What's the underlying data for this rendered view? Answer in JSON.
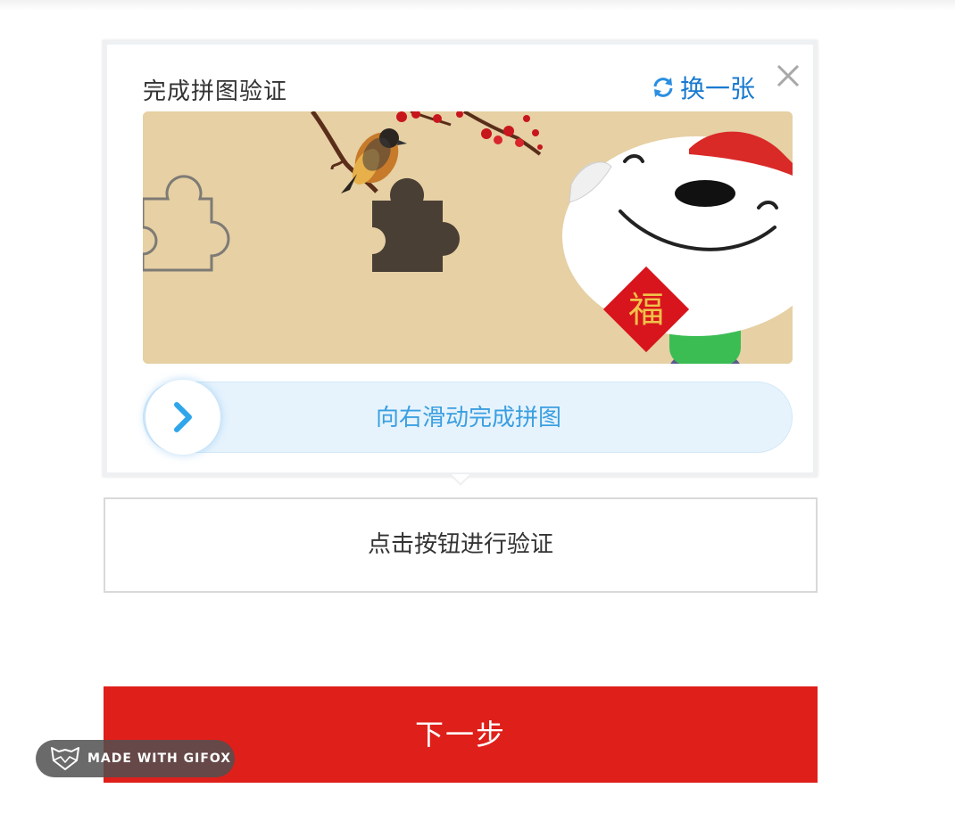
{
  "captcha": {
    "title": "完成拼图验证",
    "refresh_label": "换一张",
    "close_icon": "close-icon",
    "refresh_icon": "refresh-icon",
    "image_badge": "福",
    "slider_hint": "向右滑动完成拼图",
    "slider_handle_icon": "chevron-right-icon",
    "slider_progress": 0
  },
  "verify_button_label": "点击按钮进行验证",
  "next_button_label": "下一步",
  "watermark": "MADE WITH GIFOX",
  "colors": {
    "accent_blue": "#1a7ad0",
    "slider_hint": "#3a9fe0",
    "primary_red": "#df1f1a",
    "image_bg": "#e6d0a4"
  }
}
